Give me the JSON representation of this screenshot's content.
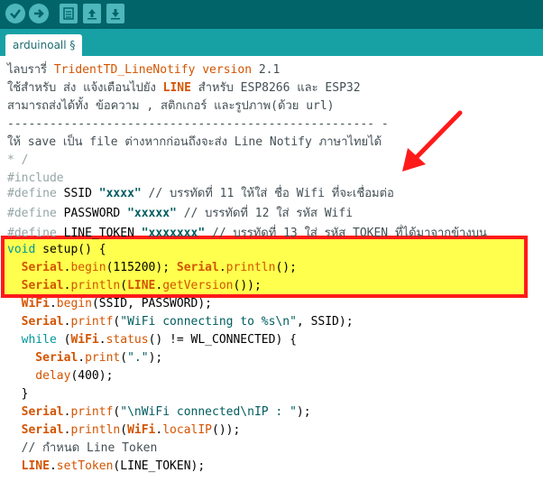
{
  "tab": {
    "label": "arduinoall §"
  },
  "toolbar": {
    "icons": [
      "verify-icon",
      "upload-icon",
      "new-icon",
      "open-icon",
      "save-icon"
    ]
  },
  "lines": {
    "l1a": "ไลบรารี่ ",
    "l1b": "TridentTD_LineNotify",
    "l1c": " ",
    "l1d": "version",
    "l1e": " 2.1",
    "l2a": "ใช้สำหรับ ส่ง แจ้งเตือนไปยัง ",
    "l2b": "LINE",
    "l2c": " สำหรับ ESP8266 และ ESP32",
    "l3": "สามารถส่งได้ทั้ง ข้อความ , สติกเกอร์ และรูปภาพ(ด้วย url)",
    "l4": "---------------------------------------------------- -",
    "l5": "ให้ save เป็น file ต่างหากก่อนถึงจะส่ง Line Notify ภาษาไทยได้",
    "l6": "* /",
    "l7": "#include",
    "d1a": "#define",
    "d1b": " SSID ",
    "d1c": "\"xxxx\"",
    "d1d": " // บรรทัดที่ 11 ให้ใส่ ชื่อ Wifi ที่จะเชื่อมต่อ",
    "d2a": "#define",
    "d2b": " PASSWORD ",
    "d2c": "\"xxxxx\"",
    "d2d": " // บรรทัดที่ 12 ใส่ รหัส Wifi",
    "d3a": "#define",
    "d3b": " LINE_TOKEN ",
    "d3c": "\"xxxxxxx\"",
    "d3d": " // บรรทัดที่ 13 ใส่ รหัส TOKEN ที่ได้มาจากข้างบน",
    "s1a": "void",
    "s1b": " setup",
    "s1c": "() {",
    "s2a": "  Serial",
    "s2b": ".",
    "s2c": "begin",
    "s2d": "(115200); ",
    "s2e": "Serial",
    "s2f": ".",
    "s2g": "println",
    "s2h": "();",
    "s3a": "  Serial",
    "s3b": ".",
    "s3c": "println",
    "s3d": "(",
    "s3e": "LINE",
    "s3f": ".",
    "s3g": "getVersion",
    "s3h": "());",
    "s4a": "  WiFi",
    "s4b": ".",
    "s4c": "begin",
    "s4d": "(SSID, PASSWORD);",
    "s5a": "  Serial",
    "s5b": ".",
    "s5c": "printf",
    "s5d": "(",
    "s5e": "\"WiFi connecting to %s\\n\"",
    "s5f": ", SSID);",
    "s6a": "  while",
    "s6b": " (",
    "s6c": "WiFi",
    "s6d": ".",
    "s6e": "status",
    "s6f": "() != WL_CONNECTED) {",
    "s7a": "    Serial",
    "s7b": ".",
    "s7c": "print",
    "s7d": "(",
    "s7e": "\".\"",
    "s7f": ");",
    "s8a": "    delay",
    "s8b": "(400);",
    "s9": "  }",
    "s10a": "  Serial",
    "s10b": ".",
    "s10c": "printf",
    "s10d": "(",
    "s10e": "\"\\nWiFi connected\\nIP : \"",
    "s10f": ");",
    "s11a": "  Serial",
    "s11b": ".",
    "s11c": "println",
    "s11d": "(",
    "s11e": "WiFi",
    "s11f": ".",
    "s11g": "localIP",
    "s11h": "());",
    "s12": "  // กำหนด Line Token",
    "s13a": "  LINE",
    "s13b": ".",
    "s13c": "setToken",
    "s13d": "(LINE_TOKEN);"
  },
  "colors": {
    "toolbar": "#006468",
    "tabbar": "#17a1a5",
    "highlight": "#ffff4d",
    "highlight_border": "#ff1a1a",
    "arrow": "#ff1a1a"
  }
}
